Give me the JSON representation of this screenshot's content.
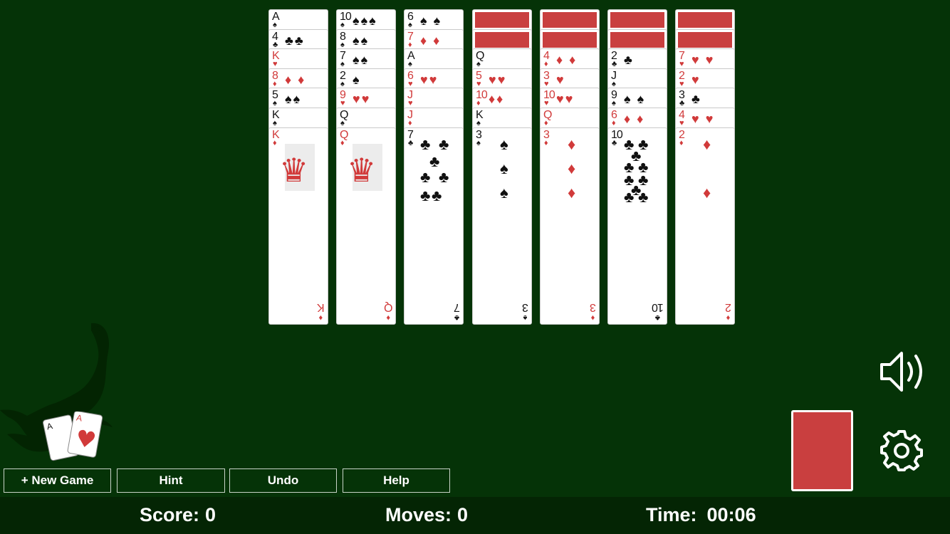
{
  "tableau": [
    {
      "cards": [
        {
          "rank": "A",
          "suit": "♠",
          "color": "black",
          "pips": ""
        },
        {
          "rank": "4",
          "suit": "♣",
          "color": "black",
          "pips": "♣♣"
        },
        {
          "rank": "K",
          "suit": "♥",
          "color": "red",
          "pips": ""
        },
        {
          "rank": "8",
          "suit": "♦",
          "color": "red",
          "pips": "♦ ♦"
        },
        {
          "rank": "5",
          "suit": "♠",
          "color": "black",
          "pips": "♠♠"
        },
        {
          "rank": "K",
          "suit": "♠",
          "color": "black",
          "pips": ""
        },
        {
          "rank": "K",
          "suit": "♦",
          "color": "red",
          "pips": "",
          "face": "king"
        }
      ]
    },
    {
      "cards": [
        {
          "rank": "10",
          "suit": "♠",
          "color": "black",
          "pips": "♠♠♠"
        },
        {
          "rank": "8",
          "suit": "♠",
          "color": "black",
          "pips": "♠♠"
        },
        {
          "rank": "7",
          "suit": "♠",
          "color": "black",
          "pips": "♠♠"
        },
        {
          "rank": "2",
          "suit": "♠",
          "color": "black",
          "pips": " ♠"
        },
        {
          "rank": "9",
          "suit": "♥",
          "color": "red",
          "pips": "♥♥"
        },
        {
          "rank": "Q",
          "suit": "♠",
          "color": "black",
          "pips": ""
        },
        {
          "rank": "Q",
          "suit": "♦",
          "color": "red",
          "pips": "",
          "face": "queen"
        }
      ]
    },
    {
      "cards": [
        {
          "rank": "6",
          "suit": "♠",
          "color": "black",
          "pips": "♠ ♠"
        },
        {
          "rank": "7",
          "suit": "♦",
          "color": "red",
          "pips": "♦ ♦"
        },
        {
          "rank": "A",
          "suit": "♠",
          "color": "black",
          "pips": ""
        },
        {
          "rank": "6",
          "suit": "♥",
          "color": "red",
          "pips": "♥♥"
        },
        {
          "rank": "J",
          "suit": "♥",
          "color": "red",
          "pips": ""
        },
        {
          "rank": "J",
          "suit": "♦",
          "color": "red",
          "pips": ""
        },
        {
          "rank": "7",
          "suit": "♣",
          "color": "black",
          "pips": "",
          "big": "seven"
        }
      ]
    },
    {
      "backs": 2,
      "cards": [
        {
          "rank": "Q",
          "suit": "♠",
          "color": "black",
          "pips": ""
        },
        {
          "rank": "5",
          "suit": "♥",
          "color": "red",
          "pips": "♥♥"
        },
        {
          "rank": "10",
          "suit": "♦",
          "color": "red",
          "pips": "♦♦"
        },
        {
          "rank": "K",
          "suit": "♠",
          "color": "black",
          "pips": ""
        },
        {
          "rank": "3",
          "suit": "♠",
          "color": "black",
          "pips": "",
          "big": "three"
        }
      ]
    },
    {
      "backs": 2,
      "cards": [
        {
          "rank": "4",
          "suit": "♦",
          "color": "red",
          "pips": "♦ ♦"
        },
        {
          "rank": "3",
          "suit": "♥",
          "color": "red",
          "pips": " ♥"
        },
        {
          "rank": "10",
          "suit": "♥",
          "color": "red",
          "pips": "♥♥"
        },
        {
          "rank": "Q",
          "suit": "♦",
          "color": "red",
          "pips": ""
        },
        {
          "rank": "3",
          "suit": "♦",
          "color": "red",
          "pips": "",
          "big": "three"
        }
      ]
    },
    {
      "backs": 2,
      "cards": [
        {
          "rank": "2",
          "suit": "♣",
          "color": "black",
          "pips": " ♣"
        },
        {
          "rank": "J",
          "suit": "♠",
          "color": "black",
          "pips": ""
        },
        {
          "rank": "9",
          "suit": "♠",
          "color": "black",
          "pips": "♠ ♠"
        },
        {
          "rank": "6",
          "suit": "♦",
          "color": "red",
          "pips": "♦ ♦"
        },
        {
          "rank": "10",
          "suit": "♣",
          "color": "black",
          "pips": "",
          "big": "ten"
        }
      ]
    },
    {
      "backs": 2,
      "cards": [
        {
          "rank": "7",
          "suit": "♥",
          "color": "red",
          "pips": "♥ ♥"
        },
        {
          "rank": "2",
          "suit": "♥",
          "color": "red",
          "pips": " ♥"
        },
        {
          "rank": "3",
          "suit": "♣",
          "color": "black",
          "pips": " ♣"
        },
        {
          "rank": "4",
          "suit": "♥",
          "color": "red",
          "pips": "♥ ♥"
        },
        {
          "rank": "2",
          "suit": "♦",
          "color": "red",
          "pips": "",
          "big": "two"
        }
      ]
    }
  ],
  "logo": {
    "card1_rank": "A",
    "card2_rank": "A"
  },
  "buttons": {
    "new_game": "+ New Game",
    "hint": "Hint",
    "undo": "Undo",
    "help": "Help"
  },
  "status": {
    "score_label": "Score:",
    "score_value": "0",
    "moves_label": "Moves:",
    "moves_value": "0",
    "time_label": "Time:",
    "time_value": "00:06"
  },
  "icons": {
    "sound": "speaker-icon",
    "settings": "gear-icon",
    "stock": "card-back"
  },
  "colors": {
    "felt": "#053307",
    "status_bar": "#042504",
    "card_back": "#c93f3f",
    "red_suit": "#d13a3a"
  }
}
